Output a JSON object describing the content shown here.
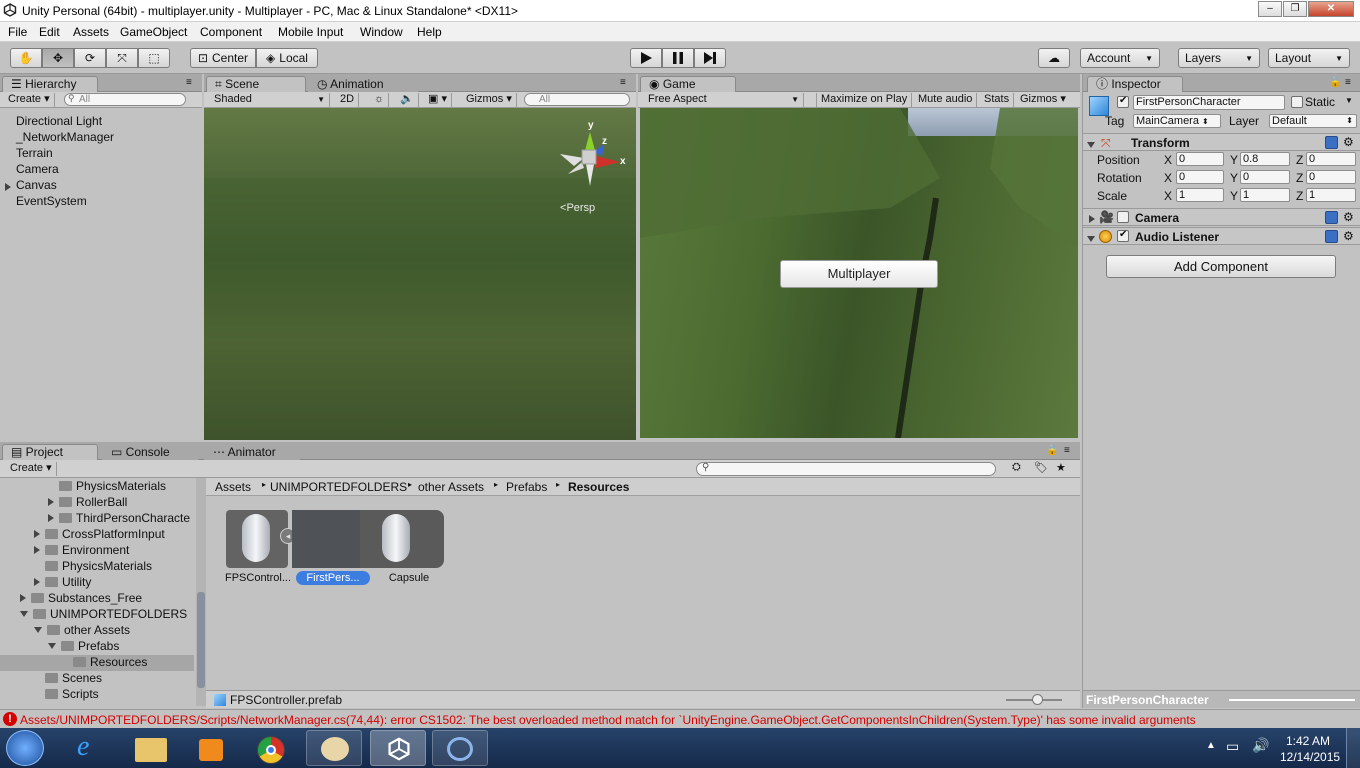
{
  "window": {
    "title": "Unity Personal (64bit) - multiplayer.unity - Multiplayer - PC, Mac & Linux Standalone* <DX11>"
  },
  "menu": [
    "File",
    "Edit",
    "Assets",
    "GameObject",
    "Component",
    "Mobile Input",
    "Window",
    "Help"
  ],
  "toolbar": {
    "pivot": "Center",
    "space": "Local",
    "account": "Account",
    "layers": "Layers",
    "layout": "Layout"
  },
  "hierarchy": {
    "tab": "Hierarchy",
    "create": "Create",
    "search_placeholder": "All",
    "items": [
      "Directional Light",
      "_NetworkManager",
      "Terrain",
      "Camera",
      "Canvas",
      "EventSystem"
    ]
  },
  "scene": {
    "tabs": [
      "Scene",
      "Animation"
    ],
    "shading": "Shaded",
    "mode2d": "2D",
    "gizmos": "Gizmos",
    "search_placeholder": "All",
    "persp_label": "Persp",
    "axis": {
      "y": "y",
      "z": "z",
      "x": "x"
    }
  },
  "game": {
    "tab": "Game",
    "aspect": "Free Aspect",
    "maximize": "Maximize on Play",
    "mute": "Mute audio",
    "stats": "Stats",
    "gizmos": "Gizmos",
    "button": "Multiplayer"
  },
  "inspector": {
    "tab": "Inspector",
    "object_name": "FirstPersonCharacter",
    "static_label": "Static",
    "tag_label": "Tag",
    "tag_value": "MainCamera",
    "layer_label": "Layer",
    "layer_value": "Default",
    "transform": {
      "title": "Transform",
      "position_label": "Position",
      "rotation_label": "Rotation",
      "scale_label": "Scale",
      "position": [
        "0",
        "0.8",
        "0"
      ],
      "rotation": [
        "0",
        "0",
        "0"
      ],
      "scale": [
        "1",
        "1",
        "1"
      ],
      "axes": [
        "X",
        "Y",
        "Z"
      ]
    },
    "camera": "Camera",
    "audio_listener": "Audio Listener",
    "add_component": "Add Component",
    "footer": "FirstPersonCharacter"
  },
  "bottom_tabs": [
    "Project",
    "Console",
    "Animator"
  ],
  "project": {
    "create": "Create",
    "tree": [
      {
        "label": "PhysicsMaterials",
        "indent": 3,
        "arrow": "none"
      },
      {
        "label": "RollerBall",
        "indent": 3,
        "arrow": "right"
      },
      {
        "label": "ThirdPersonCharacte",
        "indent": 3,
        "arrow": "right"
      },
      {
        "label": "CrossPlatformInput",
        "indent": 2,
        "arrow": "right"
      },
      {
        "label": "Environment",
        "indent": 2,
        "arrow": "right"
      },
      {
        "label": "PhysicsMaterials",
        "indent": 2,
        "arrow": "none"
      },
      {
        "label": "Utility",
        "indent": 2,
        "arrow": "right"
      },
      {
        "label": "Substances_Free",
        "indent": 1,
        "arrow": "right"
      },
      {
        "label": "UNIMPORTEDFOLDERS",
        "indent": 1,
        "arrow": "down"
      },
      {
        "label": "other Assets",
        "indent": 2,
        "arrow": "down"
      },
      {
        "label": "Prefabs",
        "indent": 3,
        "arrow": "down"
      },
      {
        "label": "Resources",
        "indent": 4,
        "arrow": "none",
        "selected": true
      },
      {
        "label": "Scenes",
        "indent": 2,
        "arrow": "none"
      },
      {
        "label": "Scripts",
        "indent": 2,
        "arrow": "none"
      }
    ],
    "breadcrumb": [
      "Assets",
      "UNIMPORTEDFOLDERS",
      "other Assets",
      "Prefabs",
      "Resources"
    ],
    "assets": [
      {
        "label": "FPSControl...",
        "selected": false
      },
      {
        "label": "FirstPers...",
        "selected": true
      },
      {
        "label": "Capsule",
        "selected": false
      }
    ],
    "status_file": "FPSController.prefab"
  },
  "console": {
    "error": "Assets/UNIMPORTEDFOLDERS/Scripts/NetworkManager.cs(74,44): error CS1502: The best overloaded method match for `UnityEngine.GameObject.GetComponentsInChildren(System.Type)' has some invalid arguments"
  },
  "taskbar": {
    "time": "1:42 AM",
    "date": "12/14/2015",
    "apps": [
      "start-orb",
      "internet-explorer",
      "file-explorer",
      "media-player",
      "chrome",
      "paint",
      "unity",
      "unity-pinned"
    ]
  },
  "colors": {
    "selection": "#3e7de0",
    "error": "#d40000",
    "grass": "#4e6a33",
    "taskbar": "#1c3358"
  }
}
